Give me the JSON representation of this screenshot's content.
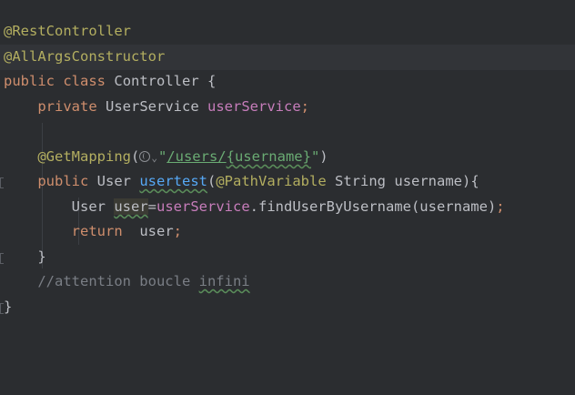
{
  "editor": {
    "line1": {
      "annotation": "@RestController"
    },
    "line2": {
      "annotation": "@AllArgsConstructor"
    },
    "line3": {
      "kw1": "public",
      "kw2": "class",
      "name": "Controller",
      "brace": "{"
    },
    "line4": {
      "kw": "private",
      "type": "UserService",
      "field": "userService",
      "semi": ";"
    },
    "line6": {
      "annotation": "@GetMapping",
      "open": "(",
      "quote_open": "\"",
      "url_prefix": "/users/",
      "url_param": "{username}",
      "quote_close": "\"",
      "close": ")"
    },
    "line7": {
      "kw": "public",
      "type": "User",
      "method": "usertest",
      "open": "(",
      "param_ann": "@PathVariable",
      "param_type": "String",
      "param_name": "username",
      "close": "){"
    },
    "line8": {
      "type": "User",
      "var": "user",
      "eq": "=",
      "field": "userService",
      "call": ".findUserByUsername(username)",
      "semi": ";"
    },
    "line9": {
      "kw": "return",
      "var": "user",
      "semi": ";"
    },
    "line10": {
      "brace": "}"
    },
    "line11": {
      "comment_prefix": "//attention boucle ",
      "comment_word": "infini"
    },
    "line12": {
      "brace": "}"
    }
  },
  "icons": {
    "web_icon": "globe-icon",
    "chevron": "chevron-down-icon"
  },
  "colors": {
    "background": "#2b2d30",
    "keyword": "#cf8e6d",
    "annotation": "#b3ae60",
    "field": "#c77dbb",
    "method": "#56a8f5",
    "string": "#6aab73",
    "comment": "#7a7e85"
  }
}
